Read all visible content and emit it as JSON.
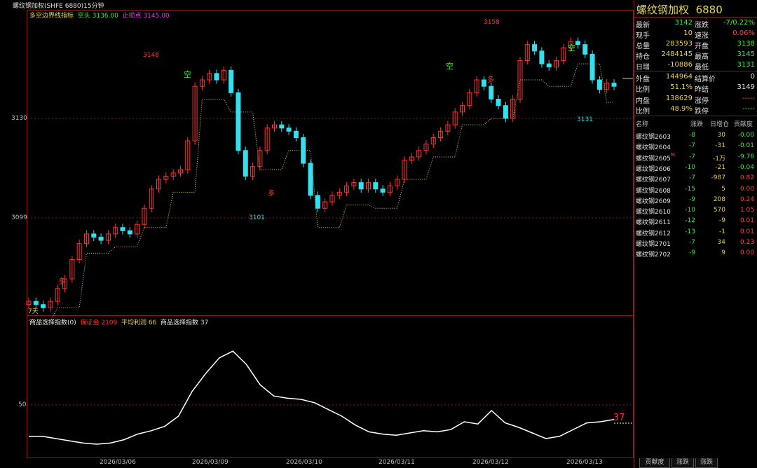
{
  "window": {
    "title": "螺纹钢加权(SHFE 6880)15分钟"
  },
  "indicator_main": {
    "name": "多空边界线指标",
    "label1": "空头 3136.00",
    "label2": "止损点 3145.00"
  },
  "indicator_sub": {
    "name": "商品选择指数(0)",
    "label1": "保证金 2109",
    "label2": "平均利润 66",
    "label3": "商品选择指数 37"
  },
  "price_axis": {
    "ticks": [
      "3130",
      "3099"
    ],
    "sub_ticks": [
      "50"
    ]
  },
  "date_axis": {
    "labels": [
      "2026/03/06",
      "2026/03/09",
      "2026/03/10",
      "2026/03/11",
      "2026/03/12",
      "2026/03/13"
    ]
  },
  "annotations": {
    "high1": "3148",
    "low1": "3101",
    "high2": "3158",
    "low2": "3131",
    "sig_long1": "多",
    "sig_long2": "多",
    "sig_long3": "多",
    "sig_short1": "空",
    "sig_short2": "空",
    "sig_short3": "空",
    "days": "7天",
    "last_index": "37"
  },
  "quote": {
    "title": "螺纹钢加权",
    "code": "6880",
    "rows": [
      {
        "l1": "最新",
        "v1": "3142",
        "c1": "#33ee33",
        "l2": "涨跌",
        "v2": "-7/0.22%",
        "c2": "#33ee33"
      },
      {
        "l1": "现手",
        "v1": "10",
        "c1": "#e8d44d",
        "l2": "速涨",
        "v2": "0.06%",
        "c2": "#ff4444"
      },
      {
        "l1": "总量",
        "v1": "283593",
        "c1": "#e8d44d",
        "l2": "开盘",
        "v2": "3138",
        "c2": "#33ee33"
      },
      {
        "l1": "持仓",
        "v1": "2484145",
        "c1": "#e8d44d",
        "l2": "最高",
        "v2": "3145",
        "c2": "#33ee33"
      },
      {
        "l1": "日增",
        "v1": "-10886",
        "c1": "#e8d44d",
        "l2": "最低",
        "v2": "3131",
        "c2": "#33ee33"
      },
      {
        "l1": "外盘",
        "v1": "144964",
        "c1": "#e8d44d",
        "l2": "结算价",
        "v2": "0",
        "c2": "#e0e0e0"
      },
      {
        "l1": "比例",
        "v1": "51.1%",
        "c1": "#e8d44d",
        "l2": "昨结",
        "v2": "3149",
        "c2": "#e0e0e0"
      },
      {
        "l1": "内盘",
        "v1": "138629",
        "c1": "#e8d44d",
        "l2": "涨停",
        "v2": "-----",
        "c2": "#ff4444"
      },
      {
        "l1": "比例",
        "v1": "48.9%",
        "c1": "#e8d44d",
        "l2": "跌停",
        "v2": "-----",
        "c2": "#33ee33"
      }
    ],
    "contracts_header": {
      "name": "名称",
      "chg": "涨跌",
      "oi": "日增仓",
      "contrib": "贡献度"
    },
    "contracts": [
      {
        "name": "螺纹钢2603",
        "chg": "-8",
        "oi": "30",
        "contrib": "-0.00",
        "cc": "#33ee33"
      },
      {
        "name": "螺纹钢2604",
        "chg": "-7",
        "oi": "-31",
        "contrib": "-0.01",
        "cc": "#33ee33"
      },
      {
        "name": "螺纹钢2605",
        "mark": "M",
        "chg": "-7",
        "oi": "-1万",
        "contrib": "-9.76",
        "cc": "#33ee33"
      },
      {
        "name": "螺纹钢2606",
        "chg": "-10",
        "oi": "-21",
        "contrib": "-0.04",
        "cc": "#33ee33"
      },
      {
        "name": "螺纹钢2607",
        "chg": "-7",
        "oi": "-987",
        "contrib": "0.82",
        "cc": "#ff4444"
      },
      {
        "name": "螺纹钢2608",
        "chg": "-15",
        "oi": "5",
        "contrib": "0.00",
        "cc": "#ff4444"
      },
      {
        "name": "螺纹钢2609",
        "chg": "-9",
        "oi": "208",
        "contrib": "0.24",
        "cc": "#ff4444"
      },
      {
        "name": "螺纹钢2610",
        "chg": "-10",
        "oi": "570",
        "contrib": "1.05",
        "cc": "#ff4444"
      },
      {
        "name": "螺纹钢2611",
        "chg": "-12",
        "oi": "-9",
        "contrib": "0.01",
        "cc": "#ff4444"
      },
      {
        "name": "螺纹钢2612",
        "chg": "-13",
        "oi": "-1",
        "contrib": "0.01",
        "cc": "#ff4444"
      },
      {
        "name": "螺纹钢2701",
        "chg": "-7",
        "oi": "34",
        "contrib": "0.23",
        "cc": "#ff4444"
      },
      {
        "name": "螺纹钢2702",
        "chg": "-9",
        "oi": "9",
        "contrib": "0.00",
        "cc": "#ff4444"
      }
    ]
  },
  "tabs": [
    "贡献度",
    "涨跌",
    "涨跌"
  ],
  "colors": {
    "up": "#ff3030",
    "down": "#33e0ee",
    "frame": "#8b1a1a",
    "support": "#e8d44d",
    "resist": "#33cc33"
  },
  "chart_data": [
    {
      "type": "candlestick",
      "title": "螺纹钢加权(SHFE 6880)15分钟",
      "series_note": "15-minute OHLC bars, approx values read from price axis",
      "x": [
        "2026/03/06",
        "2026/03/09",
        "2026/03/10",
        "2026/03/11",
        "2026/03/12",
        "2026/03/13"
      ],
      "y_ticks": [
        3130,
        3099
      ],
      "closes": [
        3073,
        3072,
        3071,
        3073,
        3077,
        3080,
        3086,
        3091,
        3094,
        3093,
        3092,
        3094,
        3096,
        3095,
        3094,
        3097,
        3102,
        3108,
        3111,
        3112,
        3113,
        3114,
        3123,
        3140,
        3142,
        3144,
        3142,
        3145,
        3138,
        3120,
        3112,
        3115,
        3120,
        3127,
        3128,
        3127,
        3126,
        3124,
        3116,
        3106,
        3102,
        3104,
        3106,
        3107,
        3109,
        3110,
        3108,
        3110,
        3108,
        3107,
        3109,
        3111,
        3117,
        3118,
        3120,
        3122,
        3124,
        3126,
        3128,
        3132,
        3134,
        3138,
        3142,
        3140,
        3136,
        3134,
        3130,
        3136,
        3148,
        3153,
        3151,
        3147,
        3146,
        3148,
        3152,
        3154,
        3153,
        3150,
        3142,
        3139,
        3141,
        3140
      ],
      "annotations": {
        "high": [
          3148,
          3158
        ],
        "low": [
          3101,
          3131
        ]
      }
    },
    {
      "type": "line",
      "name": "商品选择指数",
      "values": [
        22,
        22,
        20,
        18,
        16,
        15,
        16,
        19,
        24,
        27,
        31,
        40,
        62,
        78,
        92,
        98,
        86,
        68,
        58,
        56,
        55,
        52,
        46,
        40,
        32,
        26,
        24,
        23,
        25,
        27,
        26,
        28,
        35,
        33,
        45,
        34,
        30,
        25,
        20,
        22,
        28,
        34,
        35,
        37
      ],
      "y_ticks": [
        50
      ],
      "last": 37
    }
  ]
}
